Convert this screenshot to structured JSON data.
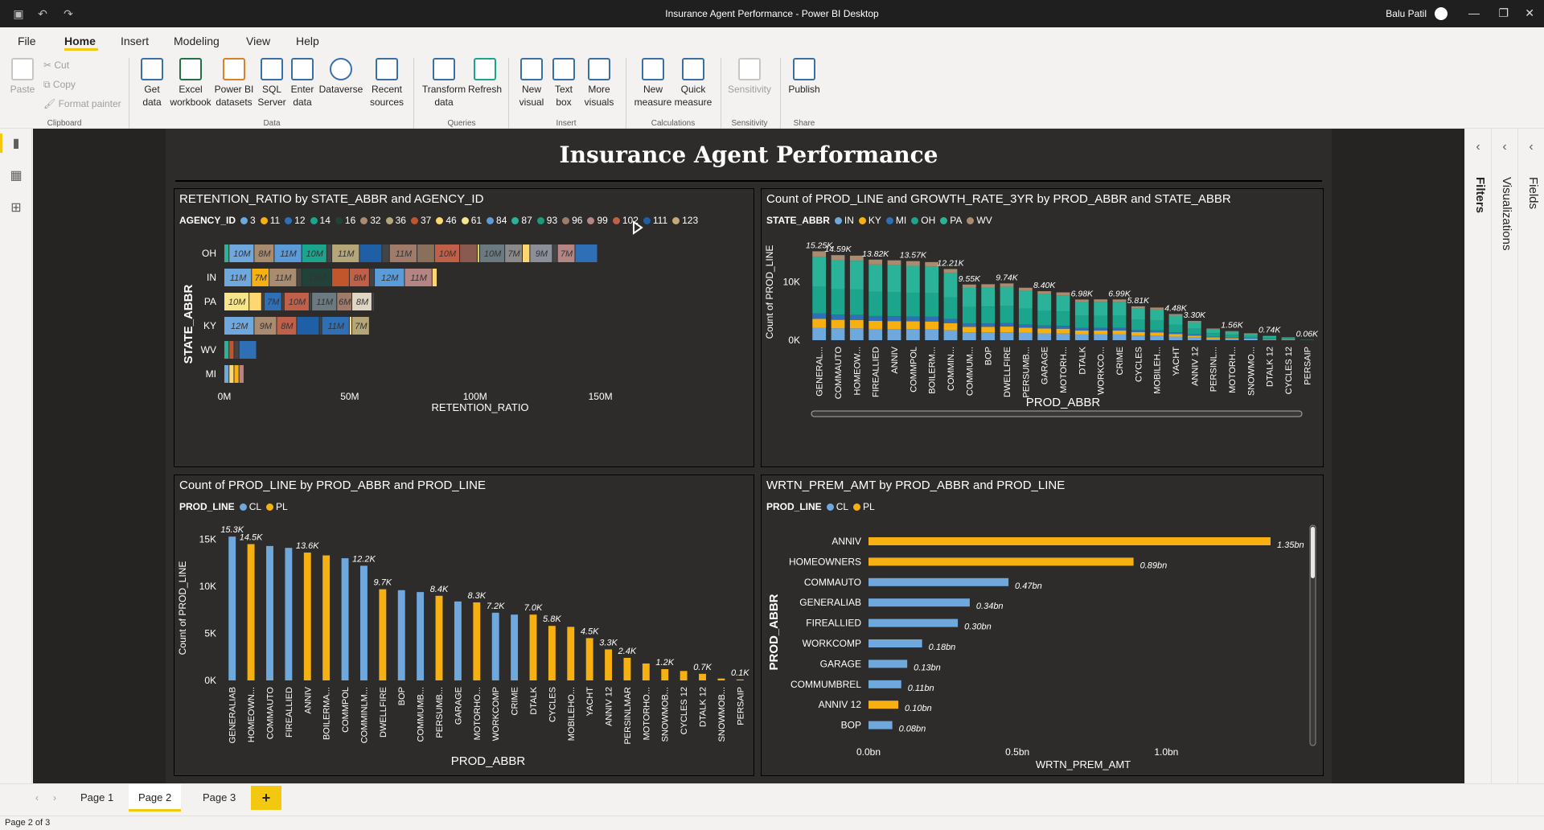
{
  "window": {
    "title": "Insurance Agent Performance - Power BI Desktop",
    "user": "Balu Patil"
  },
  "menu": [
    "File",
    "Home",
    "Insert",
    "Modeling",
    "View",
    "Help"
  ],
  "ribbon": {
    "clipboard": {
      "paste": "Paste",
      "cut": "Cut",
      "copy": "Copy",
      "format_painter": "Format painter",
      "group": "Clipboard"
    },
    "data": {
      "get_data": "Get data",
      "excel": "Excel workbook",
      "pbi_datasets": "Power BI datasets",
      "sql": "SQL Server",
      "enter": "Enter data",
      "dataverse": "Dataverse",
      "recent": "Recent sources",
      "group": "Data"
    },
    "queries": {
      "transform": "Transform data",
      "refresh": "Refresh",
      "group": "Queries"
    },
    "insert": {
      "new_visual": "New visual",
      "text_box": "Text box",
      "more_visuals": "More visuals",
      "group": "Insert"
    },
    "calculations": {
      "new_measure": "New measure",
      "quick_measure": "Quick measure",
      "group": "Calculations"
    },
    "sensitivity": {
      "label": "Sensitivity",
      "group": "Sensitivity"
    },
    "share": {
      "publish": "Publish",
      "group": "Share"
    }
  },
  "report_title": "Insurance Agent Performance",
  "panes": {
    "filters": "Filters",
    "visualizations": "Visualizations",
    "fields": "Fields"
  },
  "tabs": [
    "Page 1",
    "Page 2",
    "Page 3"
  ],
  "add_tab": "+",
  "status": "Page 2 of 3",
  "visuals": {
    "v1": {
      "title": "RETENTION_RATIO by STATE_ABBR and AGENCY_ID",
      "legend_title": "AGENCY_ID"
    },
    "v2": {
      "title": "Count of PROD_LINE and GROWTH_RATE_3YR by PROD_ABBR and STATE_ABBR",
      "legend_title": "STATE_ABBR"
    },
    "v3": {
      "title": "Count of PROD_LINE by PROD_ABBR and PROD_LINE",
      "legend_title": "PROD_LINE"
    },
    "v4": {
      "title": "WRTN_PREM_AMT by PROD_ABBR and PROD_LINE",
      "legend_title": "PROD_LINE"
    }
  },
  "chart_data": [
    {
      "type": "bar",
      "orientation": "horizontal",
      "stacked": true,
      "title": "RETENTION_RATIO by STATE_ABBR and AGENCY_ID",
      "xlabel": "RETENTION_RATIO",
      "ylabel": "STATE_ABBR",
      "xlim": [
        0,
        170000000
      ],
      "x_ticks": [
        "0M",
        "50M",
        "100M",
        "150M"
      ],
      "legend": {
        "title": "AGENCY_ID",
        "entries": [
          {
            "name": "3",
            "color": "#6fa8dc"
          },
          {
            "name": "11",
            "color": "#f6b012"
          },
          {
            "name": "12",
            "color": "#2e6fb5"
          },
          {
            "name": "14",
            "color": "#1aa58c"
          },
          {
            "name": "16",
            "color": "#204238"
          },
          {
            "name": "32",
            "color": "#a98c6f"
          },
          {
            "name": "36",
            "color": "#b5a67a"
          },
          {
            "name": "37",
            "color": "#c1562d"
          },
          {
            "name": "46",
            "color": "#ffd770"
          },
          {
            "name": "61",
            "color": "#f7e58a"
          },
          {
            "name": "84",
            "color": "#5a9bd8"
          },
          {
            "name": "87",
            "color": "#2bb39a"
          },
          {
            "name": "93",
            "color": "#1d9a7c"
          },
          {
            "name": "96",
            "color": "#a07b6a"
          },
          {
            "name": "99",
            "color": "#b58583"
          },
          {
            "name": "102",
            "color": "#c06048"
          },
          {
            "name": "111",
            "color": "#1f5fa5"
          },
          {
            "name": "123",
            "color": "#c6a97a"
          }
        ]
      },
      "categories": [
        "OH",
        "IN",
        "PA",
        "KY",
        "WV",
        "MI"
      ],
      "segments": [
        [
          {
            "v": 2000000.0,
            "c": "#2bb39a"
          },
          {
            "v": 10000000.0,
            "c": "#6fa8dc",
            "l": "10M"
          },
          {
            "v": 8000000.0,
            "c": "#a98c6f",
            "l": "8M"
          },
          {
            "v": 11000000.0,
            "c": "#5a9bd8",
            "l": "11M"
          },
          {
            "v": 10000000.0,
            "c": "#1aa58c",
            "l": "10M"
          },
          {
            "v": 2000000.0,
            "c": "#444444"
          },
          {
            "v": 11000000.0,
            "c": "#b5a67a",
            "l": "11M"
          },
          {
            "v": 9000000.0,
            "c": "#1f5fa5"
          },
          {
            "v": 3000000.0,
            "c": "#444444"
          },
          {
            "v": 11000000.0,
            "c": "#a07b6a",
            "l": "11M"
          },
          {
            "v": 7000000.0,
            "c": "#8a6f5a"
          },
          {
            "v": 10000000.0,
            "c": "#c06048",
            "l": "10M"
          },
          {
            "v": 7000000.0,
            "c": "#8a5a50"
          },
          {
            "v": 1000000.0,
            "c": "#c8d85a"
          },
          {
            "v": 10000000.0,
            "c": "#6a7a80",
            "l": "10M"
          },
          {
            "v": 7000000.0,
            "c": "#8a8a8a",
            "l": "7M"
          },
          {
            "v": 3000000.0,
            "c": "#ffd770"
          },
          {
            "v": 9000000.0,
            "c": "#8a8f9a",
            "l": "9M"
          },
          {
            "v": 2000000.0,
            "c": "#444444"
          },
          {
            "v": 7000000.0,
            "c": "#b58583",
            "l": "7M"
          },
          {
            "v": 9000000.0,
            "c": "#2e6fb5"
          }
        ],
        [
          {
            "v": 11000000.0,
            "c": "#6fa8dc",
            "l": "11M"
          },
          {
            "v": 7000000.0,
            "c": "#f6b012",
            "l": "7M"
          },
          {
            "v": 11000000.0,
            "c": "#a98c6f",
            "l": "11M"
          },
          {
            "v": 2000000.0,
            "c": "#444444"
          },
          {
            "v": 12000000.0,
            "c": "#204238",
            "l": "12M"
          },
          {
            "v": 7000000.0,
            "c": "#c1562d"
          },
          {
            "v": 8000000.0,
            "c": "#c06048",
            "l": "8M"
          },
          {
            "v": 2000000.0,
            "c": "#444444"
          },
          {
            "v": 12000000.0,
            "c": "#5a9bd8",
            "l": "12M"
          },
          {
            "v": 11000000.0,
            "c": "#b58583",
            "l": "11M"
          },
          {
            "v": 2000000.0,
            "c": "#ffd770"
          }
        ],
        [
          {
            "v": 10000000.0,
            "c": "#f7e58a",
            "l": "10M"
          },
          {
            "v": 5000000.0,
            "c": "#ffd770"
          },
          {
            "v": 1000000.0,
            "c": "#444444"
          },
          {
            "v": 7000000.0,
            "c": "#2e6fb5",
            "l": "7M"
          },
          {
            "v": 1000000.0,
            "c": "#444444"
          },
          {
            "v": 10000000.0,
            "c": "#c06048",
            "l": "10M"
          },
          {
            "v": 1000000.0,
            "c": "#444444"
          },
          {
            "v": 10000000.0,
            "c": "#6a7a80",
            "l": "11M"
          },
          {
            "v": 6000000.0,
            "c": "#a07b6a",
            "l": "6M"
          },
          {
            "v": 8000000.0,
            "c": "#e0d6c4",
            "l": "8M"
          },
          {
            "v": 1000000.0,
            "c": "#444444"
          }
        ],
        [
          {
            "v": 12000000.0,
            "c": "#6fa8dc",
            "l": "12M"
          },
          {
            "v": 9000000.0,
            "c": "#a98c6f",
            "l": "9M"
          },
          {
            "v": 8000000.0,
            "c": "#c06048",
            "l": "8M"
          },
          {
            "v": 9000000.0,
            "c": "#1f5fa5"
          },
          {
            "v": 1000000.0,
            "c": "#444444"
          },
          {
            "v": 11000000.0,
            "c": "#2e6fb5",
            "l": "11M"
          },
          {
            "v": 1000000.0,
            "c": "#f7e58a"
          },
          {
            "v": 7000000.0,
            "c": "#b5a67a",
            "l": "7M"
          }
        ],
        [
          {
            "v": 2000000.0,
            "c": "#2bb39a"
          },
          {
            "v": 2000000.0,
            "c": "#c1562d"
          },
          {
            "v": 2000000.0,
            "c": "#444444"
          },
          {
            "v": 7000000.0,
            "c": "#2e6fb5"
          }
        ],
        [
          {
            "v": 2000000.0,
            "c": "#6fa8dc"
          },
          {
            "v": 2000000.0,
            "c": "#ffd770"
          },
          {
            "v": 2000000.0,
            "c": "#f6b012"
          },
          {
            "v": 2000000.0,
            "c": "#b58583"
          }
        ]
      ]
    },
    {
      "type": "bar",
      "stacked": true,
      "title": "Count of PROD_LINE and GROWTH_RATE_3YR by PROD_ABBR and STATE_ABBR",
      "xlabel": "PROD_ABBR",
      "ylabel": "Count of PROD_LINE",
      "ylim": [
        0,
        16000
      ],
      "y_ticks": [
        "0K",
        "10K"
      ],
      "legend": {
        "title": "STATE_ABBR",
        "entries": [
          {
            "name": "IN",
            "color": "#6fa8dc"
          },
          {
            "name": "KY",
            "color": "#f6b012"
          },
          {
            "name": "MI",
            "color": "#2e6fb5"
          },
          {
            "name": "OH",
            "color": "#1aa58c"
          },
          {
            "name": "PA",
            "color": "#2bb39a"
          },
          {
            "name": "WV",
            "color": "#a98c6f"
          }
        ]
      },
      "categories": [
        "GENERAL...",
        "COMMAUTO",
        "HOMEOW...",
        "FIREALLIED",
        "ANNIV",
        "COMMPOL",
        "BOILERM...",
        "COMMIN...",
        "COMMUM...",
        "BOP",
        "DWELLFIRE",
        "PERSUMB...",
        "GARAGE",
        "MOTORH...",
        "DTALK",
        "WORKCO...",
        "CRIME",
        "CYCLES",
        "MOBILEH...",
        "YACHT",
        "ANNIV 12",
        "PERSINL...",
        "MOTORH...",
        "SNOWMO...",
        "DTALK 12",
        "CYCLES 12",
        "PERSAIP"
      ],
      "totals": [
        15250,
        14590,
        14500,
        13820,
        13700,
        13570,
        13400,
        12210,
        9550,
        9600,
        9740,
        9000,
        8400,
        8200,
        6980,
        7000,
        6990,
        5810,
        5600,
        4480,
        3300,
        2000,
        1560,
        1200,
        740,
        500,
        60
      ],
      "data_labels": [
        "15.25K",
        "14.59K",
        "",
        "13.82K",
        "",
        "13.57K",
        "",
        "12.21K",
        "9.55K",
        "",
        "9.74K",
        "",
        "8.40K",
        "",
        "6.98K",
        "",
        "6.99K",
        "5.81K",
        "",
        "4.48K",
        "3.30K",
        "",
        "1.56K",
        "",
        "0.74K",
        "",
        "0.06K"
      ],
      "state_shares": {
        "IN": 0.14,
        "KY": 0.1,
        "MI": 0.06,
        "OH": 0.3,
        "PA": 0.34,
        "WV": 0.06
      }
    },
    {
      "type": "bar",
      "title": "Count of PROD_LINE by PROD_ABBR and PROD_LINE",
      "xlabel": "PROD_ABBR",
      "ylabel": "Count of PROD_LINE",
      "ylim": [
        0,
        16000
      ],
      "y_ticks": [
        "0K",
        "5K",
        "10K",
        "15K"
      ],
      "legend": {
        "title": "PROD_LINE",
        "entries": [
          {
            "name": "CL",
            "color": "#6fa8dc"
          },
          {
            "name": "PL",
            "color": "#f6b012"
          }
        ]
      },
      "categories": [
        "GENERALIAB",
        "HOMEOWN...",
        "COMMAUTO",
        "FIREALLIED",
        "ANNIV",
        "BOILERMA...",
        "COMMPOL",
        "COMMINLM...",
        "DWELLFIRE",
        "BOP",
        "COMMUMB...",
        "PERSUMB...",
        "GARAGE",
        "MOTORHO...",
        "WORKCOMP",
        "CRIME",
        "DTALK",
        "CYCLES",
        "MOBILEHO...",
        "YACHT",
        "ANNIV 12",
        "PERSINLMAR",
        "MOTORHO...",
        "SNOWMOB...",
        "CYCLES 12",
        "DTALK 12",
        "SNOWMOB...",
        "PERSAIP"
      ],
      "values": [
        15300,
        14500,
        14300,
        14100,
        13600,
        13300,
        13000,
        12200,
        9700,
        9600,
        9400,
        9000,
        8400,
        8300,
        7200,
        7000,
        7000,
        5800,
        5700,
        4500,
        3300,
        2400,
        1800,
        1200,
        1000,
        700,
        200,
        100
      ],
      "lines": [
        "CL",
        "PL",
        "CL",
        "CL",
        "PL",
        "PL",
        "CL",
        "CL",
        "PL",
        "CL",
        "CL",
        "PL",
        "CL",
        "PL",
        "CL",
        "CL",
        "PL",
        "PL",
        "PL",
        "PL",
        "PL",
        "PL",
        "PL",
        "PL",
        "PL",
        "PL",
        "PL",
        "PL"
      ],
      "data_labels": [
        "15.3K",
        "14.5K",
        "",
        "",
        "13.6K",
        "",
        "",
        "12.2K",
        "9.7K",
        "",
        "",
        "8.4K",
        "",
        "8.3K",
        "7.2K",
        "",
        "7.0K",
        "5.8K",
        "",
        "4.5K",
        "3.3K",
        "2.4K",
        "",
        "1.2K",
        "",
        "0.7K",
        "",
        "0.1K"
      ]
    },
    {
      "type": "bar",
      "orientation": "horizontal",
      "title": "WRTN_PREM_AMT by PROD_ABBR and PROD_LINE",
      "xlabel": "WRTN_PREM_AMT",
      "ylabel": "PROD_ABBR",
      "xlim": [
        0,
        1450000000
      ],
      "x_ticks": [
        "0.0bn",
        "0.5bn",
        "1.0bn"
      ],
      "legend": {
        "title": "PROD_LINE",
        "entries": [
          {
            "name": "CL",
            "color": "#6fa8dc"
          },
          {
            "name": "PL",
            "color": "#f6b012"
          }
        ]
      },
      "categories": [
        "ANNIV",
        "HOMEOWNERS",
        "COMMAUTO",
        "GENERALIAB",
        "FIREALLIED",
        "WORKCOMP",
        "GARAGE",
        "COMMUMBREL",
        "ANNIV 12",
        "BOP"
      ],
      "values": [
        1350000000,
        890000000,
        470000000,
        340000000,
        300000000,
        180000000,
        130000000,
        110000000,
        100000000,
        80000000
      ],
      "lines": [
        "PL",
        "PL",
        "CL",
        "CL",
        "CL",
        "CL",
        "CL",
        "CL",
        "PL",
        "CL"
      ],
      "data_labels": [
        "1.35bn",
        "0.89bn",
        "0.47bn",
        "0.34bn",
        "0.30bn",
        "0.18bn",
        "0.13bn",
        "0.11bn",
        "0.10bn",
        "0.08bn"
      ]
    }
  ]
}
